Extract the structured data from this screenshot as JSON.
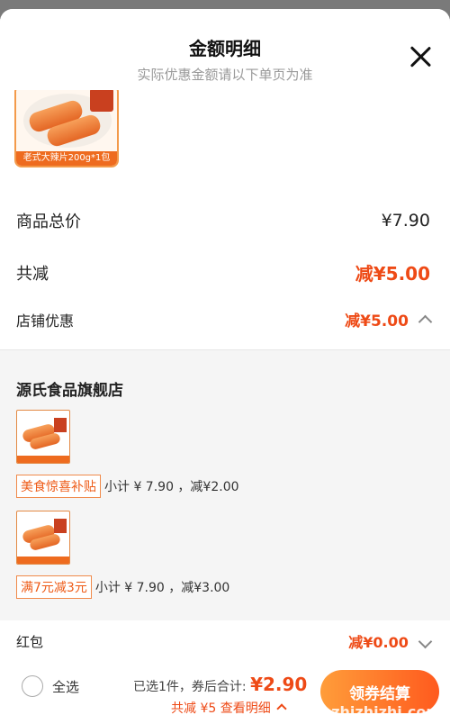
{
  "header": {
    "title": "金额明细",
    "subtitle": "实际优惠金额请以下单页为准"
  },
  "hero_product": {
    "caption": "老式大辣片200g*1包"
  },
  "summary_rows": {
    "total_label": "商品总价",
    "total_value": "¥7.90",
    "discount_label": "共减",
    "discount_value": "减¥5.00",
    "shop_discount_label": "店铺优惠",
    "shop_discount_value": "减¥5.00"
  },
  "shop": {
    "name": "源氏食品旗舰店",
    "items": [
      {
        "tag": "美食惊喜补贴",
        "detail": "小计 ¥ 7.90 ，减¥2.00"
      },
      {
        "tag": "满7元减3元",
        "detail": "小计 ¥ 7.90 ，减¥3.00"
      }
    ]
  },
  "red_packet": {
    "label": "红包",
    "value": "减¥0.00"
  },
  "footer": {
    "select_all": "全选",
    "selected_text": "已选1件，券后合计:",
    "total": "¥2.90",
    "detail_link": "共减 ¥5 查看明细",
    "checkout": "领券结算",
    "watermark": "zhizhizhi.com"
  },
  "colors": {
    "accent": "#ee4a16",
    "checkout_from": "#ff9d3a",
    "checkout_to": "#ff5a1e"
  }
}
